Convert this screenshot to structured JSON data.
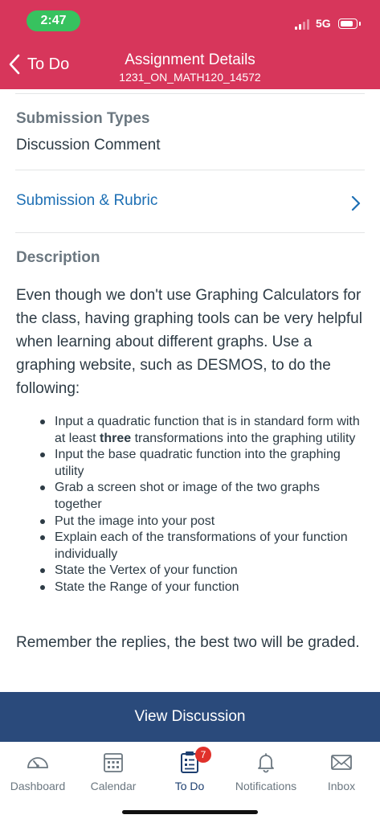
{
  "status": {
    "time": "2:47",
    "network": "5G"
  },
  "nav": {
    "back_label": "To Do",
    "title": "Assignment Details",
    "subtitle": "1231_ON_MATH120_14572"
  },
  "submission_types": {
    "label": "Submission Types",
    "value": "Discussion Comment"
  },
  "rubric": {
    "label": "Submission & Rubric"
  },
  "description": {
    "label": "Description",
    "paragraph": "Even though we don't use Graphing Calculators for the class, having graphing tools can be very helpful when learning about different graphs.  Use a graphing website, such as DESMOS, to do the following:",
    "bullets": [
      {
        "before": "Input a quadratic function that is in standard form with at least ",
        "bold": "three",
        "after": " transformations into the graphing utility"
      },
      {
        "text": "Input the base quadratic function into the graphing utility"
      },
      {
        "text": "Grab a screen shot or image of the two graphs together"
      },
      {
        "text": "Put the image into your post"
      },
      {
        "text": "Explain each of the transformations of your function individually"
      },
      {
        "text": "State the Vertex of your function"
      },
      {
        "text": "State the Range of your function"
      }
    ],
    "closing": "Remember the replies, the best two will be graded."
  },
  "view_discussion_label": "View Discussion",
  "tabbar": {
    "dashboard": {
      "label": "Dashboard",
      "icon": "dashboard-gauge-icon"
    },
    "calendar": {
      "label": "Calendar",
      "icon": "calendar-icon"
    },
    "todo": {
      "label": "To Do",
      "icon": "todo-clipboard-icon",
      "badge": "7"
    },
    "notifications": {
      "label": "Notifications",
      "icon": "bell-icon"
    },
    "inbox": {
      "label": "Inbox",
      "icon": "envelope-icon"
    }
  },
  "colors": {
    "header_bg": "#d7365b",
    "time_pill": "#37c25f",
    "link": "#1d6fb4",
    "button_bg": "#2a4a7b",
    "active_tab": "#1d3f70",
    "badge": "#e0312b"
  }
}
